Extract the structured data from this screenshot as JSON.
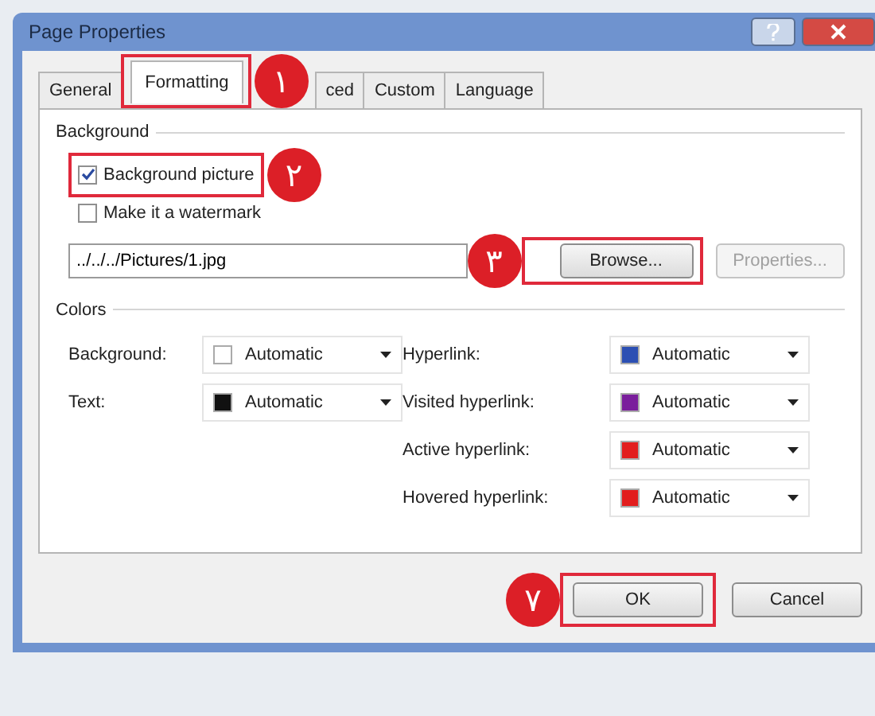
{
  "window": {
    "title": "Page Properties"
  },
  "tabs": [
    {
      "label": "General",
      "selected": false
    },
    {
      "label": "Formatting",
      "selected": true,
      "annotation": "١"
    },
    {
      "label": "ced",
      "selected": false
    },
    {
      "label": "Custom",
      "selected": false
    },
    {
      "label": "Language",
      "selected": false
    }
  ],
  "background": {
    "title": "Background",
    "options": [
      {
        "label": "Background picture",
        "checked": true,
        "annotation": "٢"
      },
      {
        "label": "Make it a watermark",
        "checked": false
      }
    ],
    "file": {
      "value": "../../../Pictures/1.jpg"
    },
    "buttons": [
      {
        "label": "Browse...",
        "disabled": false,
        "annotation": "٣"
      },
      {
        "label": "Properties...",
        "disabled": true
      }
    ]
  },
  "colors": {
    "title": "Colors",
    "left": [
      {
        "label": "Background:",
        "color": "#ffffff",
        "value": "Automatic"
      },
      {
        "label": "Text:",
        "color": "#111111",
        "value": "Automatic"
      }
    ],
    "right": [
      {
        "label": "Hyperlink:",
        "color": "#2c4fb3",
        "value": "Automatic"
      },
      {
        "label": "Visited hyperlink:",
        "color": "#7a1e9c",
        "value": "Automatic"
      },
      {
        "label": "Active hyperlink:",
        "color": "#e21d1d",
        "value": "Automatic"
      },
      {
        "label": "Hovered hyperlink:",
        "color": "#e21d1d",
        "value": "Automatic"
      }
    ]
  },
  "buttons": [
    {
      "label": "OK",
      "annotation": "٧"
    },
    {
      "label": "Cancel"
    }
  ]
}
